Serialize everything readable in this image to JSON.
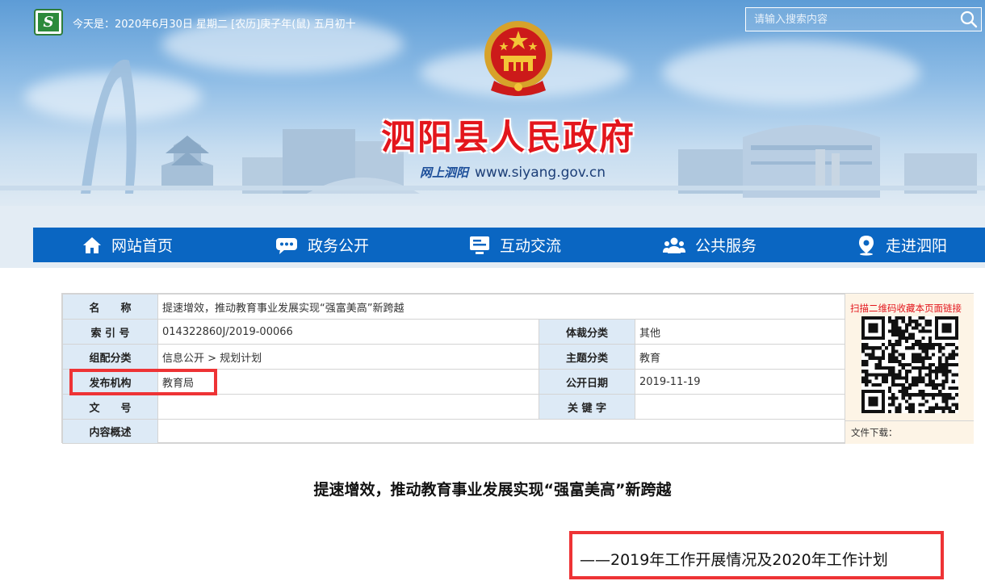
{
  "header": {
    "logo_text": "S",
    "date_line": "今天是：2020年6月30日 星期二 [农历]庚子年(鼠) 五月初十",
    "search_placeholder": "请输入搜索内容",
    "site_title": "泗阳县人民政府",
    "sub_calligraphy": "网上泗阳",
    "site_url": "www.siyang.gov.cn"
  },
  "nav": {
    "items": [
      {
        "label": "网站首页",
        "icon": "home-icon"
      },
      {
        "label": "政务公开",
        "icon": "chat-icon"
      },
      {
        "label": "互动交流",
        "icon": "monitor-icon"
      },
      {
        "label": "公共服务",
        "icon": "people-icon"
      },
      {
        "label": "走进泗阳",
        "icon": "location-pin-icon"
      }
    ]
  },
  "info": {
    "name_label": "名　　称",
    "name_value": "提速增效，推动教育事业发展实现“强富美高”新跨越",
    "index_label": "索 引 号",
    "index_value": "014322860J/2019-00066",
    "genre_label": "体裁分类",
    "genre_value": "其他",
    "group_label": "组配分类",
    "group_value": "信息公开 > 规划计划",
    "topic_label": "主题分类",
    "topic_value": "教育",
    "org_label": "发布机构",
    "org_value": "教育局",
    "date_label": "公开日期",
    "date_value": "2019-11-19",
    "docno_label": "文　　号",
    "docno_value": "",
    "keyword_label": "关 键 字",
    "keyword_value": "",
    "summary_label": "内容概述",
    "summary_value": "",
    "qr_title": "扫描二维码收藏本页面链接",
    "download_label": "文件下载："
  },
  "article": {
    "title": "提速增效，推动教育事业发展实现“强富美高”新跨越",
    "subtitle": "——2019年工作开展情况及2020年工作计划"
  },
  "colors": {
    "nav_bg": "#0a66c2",
    "title_red": "#e3161c",
    "label_bg": "#ddeaf6",
    "highlight_red": "#ee3335"
  }
}
